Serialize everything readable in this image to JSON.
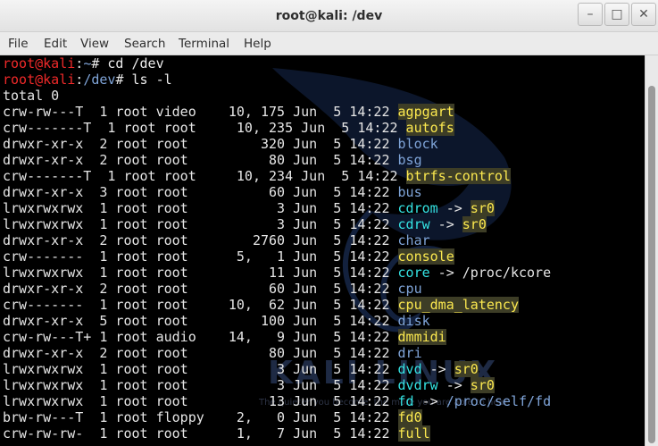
{
  "window": {
    "title": "root@kali: /dev"
  },
  "menu": [
    "File",
    "Edit",
    "View",
    "Search",
    "Terminal",
    "Help"
  ],
  "prompt": {
    "user": "root@kali",
    "home": "~",
    "dev": "/dev"
  },
  "commands": {
    "cd": "cd /dev",
    "ls": "ls -l"
  },
  "total_line": "total 0",
  "watermark": {
    "text": "KALI LINUX",
    "sub": "The quieter you become, the more you are able to hear."
  },
  "rows": [
    {
      "meta": "crw-rw---T  1 root video    10, 175 Jun  5 14:22 ",
      "name": "agpgart",
      "style": "dev"
    },
    {
      "meta": "crw-------T  1 root root     10, 235 Jun  5 14:22 ",
      "name": "autofs",
      "style": "dev"
    },
    {
      "meta": "drwxr-xr-x  2 root root         320 Jun  5 14:22 ",
      "name": "block",
      "style": "dir"
    },
    {
      "meta": "drwxr-xr-x  2 root root          80 Jun  5 14:22 ",
      "name": "bsg",
      "style": "dir"
    },
    {
      "meta": "crw-------T  1 root root     10, 234 Jun  5 14:22 ",
      "name": "btrfs-control",
      "style": "dev"
    },
    {
      "meta": "drwxr-xr-x  3 root root          60 Jun  5 14:22 ",
      "name": "bus",
      "style": "dir"
    },
    {
      "meta": "lrwxrwxrwx  1 root root           3 Jun  5 14:22 ",
      "name": "cdrom",
      "style": "link",
      "arrow": " -> ",
      "target": "sr0",
      "tstyle": "dev"
    },
    {
      "meta": "lrwxrwxrwx  1 root root           3 Jun  5 14:22 ",
      "name": "cdrw",
      "style": "link",
      "arrow": " -> ",
      "target": "sr0",
      "tstyle": "dev"
    },
    {
      "meta": "drwxr-xr-x  2 root root        2760 Jun  5 14:22 ",
      "name": "char",
      "style": "dir"
    },
    {
      "meta": "crw-------  1 root root      5,   1 Jun  5 14:22 ",
      "name": "console",
      "style": "dev"
    },
    {
      "meta": "lrwxrwxrwx  1 root root          11 Jun  5 14:22 ",
      "name": "core",
      "style": "link",
      "arrow": " -> ",
      "target": "/proc/kcore",
      "tstyle": "plain"
    },
    {
      "meta": "drwxr-xr-x  2 root root          60 Jun  5 14:22 ",
      "name": "cpu",
      "style": "dir"
    },
    {
      "meta": "crw-------  1 root root     10,  62 Jun  5 14:22 ",
      "name": "cpu_dma_latency",
      "style": "dev"
    },
    {
      "meta": "drwxr-xr-x  5 root root         100 Jun  5 14:22 ",
      "name": "disk",
      "style": "dir"
    },
    {
      "meta": "crw-rw---T+ 1 root audio    14,   9 Jun  5 14:22 ",
      "name": "dmmidi",
      "style": "dev"
    },
    {
      "meta": "drwxr-xr-x  2 root root          80 Jun  5 14:22 ",
      "name": "dri",
      "style": "dir"
    },
    {
      "meta": "lrwxrwxrwx  1 root root           3 Jun  5 14:22 ",
      "name": "dvd",
      "style": "link",
      "arrow": " -> ",
      "target": "sr0",
      "tstyle": "dev"
    },
    {
      "meta": "lrwxrwxrwx  1 root root           3 Jun  5 14:22 ",
      "name": "dvdrw",
      "style": "link",
      "arrow": " -> ",
      "target": "sr0",
      "tstyle": "dev"
    },
    {
      "meta": "lrwxrwxrwx  1 root root          13 Jun  5 14:22 ",
      "name": "fd",
      "style": "link",
      "arrow": " -> ",
      "target": "/proc/self/fd",
      "tstyle": "dir"
    },
    {
      "meta": "brw-rw---T  1 root floppy    2,   0 Jun  5 14:22 ",
      "name": "fd0",
      "style": "dev"
    },
    {
      "meta": "crw-rw-rw-  1 root root      1,   7 Jun  5 14:22 ",
      "name": "full",
      "style": "dev"
    }
  ]
}
